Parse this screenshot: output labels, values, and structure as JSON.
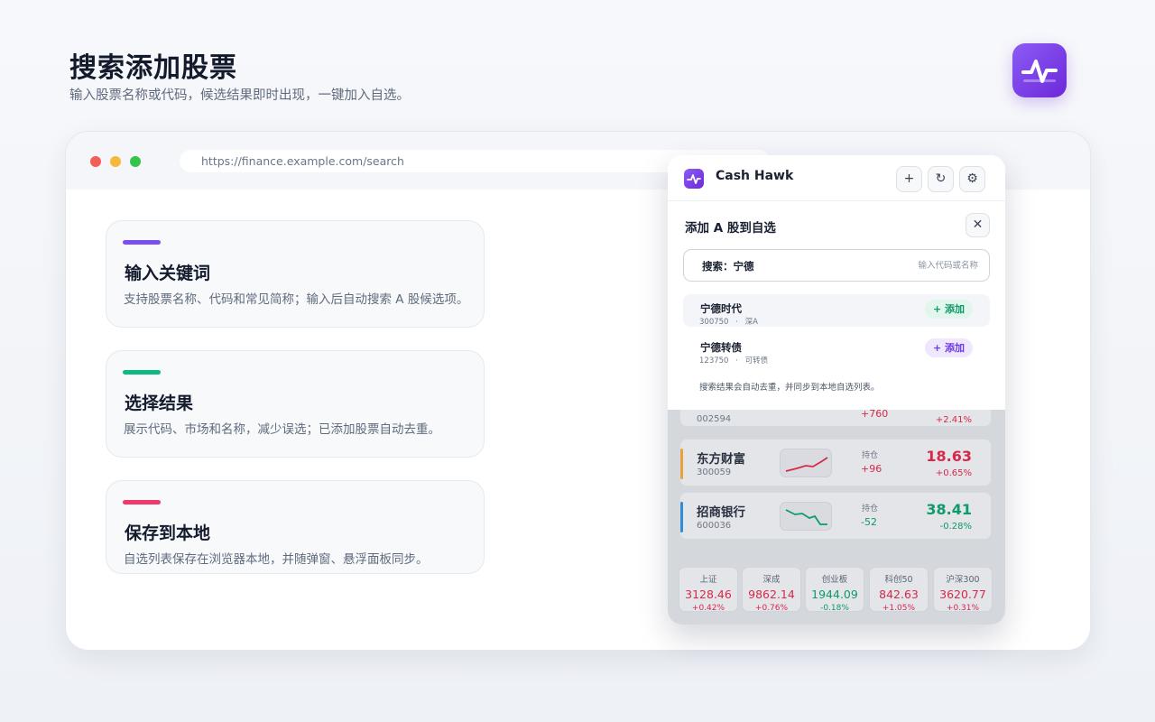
{
  "page": {
    "title": "搜索添加股票",
    "subtitle": "输入股票名称或代码，候选结果即时出现，一键加入自选。"
  },
  "browser": {
    "url": "https://finance.example.com/search"
  },
  "features": [
    {
      "title": "输入关键词",
      "desc": "支持股票名称、代码和常见简称；输入后自动搜索 A 股候选项。",
      "accent": "#7c4df0"
    },
    {
      "title": "选择结果",
      "desc": "展示代码、市场和名称，减少误选；已添加股票自动去重。",
      "accent": "#10b981"
    },
    {
      "title": "保存到本地",
      "desc": "自选列表保存在浏览器本地，并随弹窗、悬浮面板同步。",
      "accent": "#f0386b"
    }
  ],
  "panel": {
    "app_name": "Cash Hawk",
    "header_buttons": [
      {
        "name": "add-button",
        "glyph": "+"
      },
      {
        "name": "refresh-button",
        "glyph": "↻"
      },
      {
        "name": "settings-button",
        "glyph": "⚙"
      }
    ],
    "stocks": [
      {
        "name": "",
        "code": "002594",
        "hold_label": "",
        "hold_value": "+760",
        "price": "",
        "pct": "+2.41%",
        "trend": "up",
        "accent": "#7c4df0"
      },
      {
        "name": "东方财富",
        "code": "300059",
        "hold_label": "持仓",
        "hold_value": "+96",
        "price": "18.63",
        "pct": "+0.65%",
        "trend": "up",
        "accent": "#e8a23a"
      },
      {
        "name": "招商银行",
        "code": "600036",
        "hold_label": "持仓",
        "hold_value": "-52",
        "price": "38.41",
        "pct": "-0.28%",
        "trend": "down",
        "accent": "#2e8fd8"
      }
    ],
    "indices": [
      {
        "name": "上证",
        "value": "3128.46",
        "pct": "+0.42%",
        "trend": "up"
      },
      {
        "name": "深成",
        "value": "9862.14",
        "pct": "+0.76%",
        "trend": "up"
      },
      {
        "name": "创业板",
        "value": "1944.09",
        "pct": "-0.18%",
        "trend": "down"
      },
      {
        "name": "科创50",
        "value": "842.63",
        "pct": "+1.05%",
        "trend": "up"
      },
      {
        "name": "沪深300",
        "value": "3620.77",
        "pct": "+0.31%",
        "trend": "up"
      }
    ]
  },
  "popup": {
    "title": "添加 A 股到自选",
    "close_glyph": "✕",
    "search_label": "搜索：宁德",
    "search_placeholder": "输入代码或名称",
    "results": [
      {
        "name": "宁德时代",
        "code": "300750",
        "sep": "·",
        "market": "深A",
        "add_label": "+ 添加"
      },
      {
        "name": "宁德转债",
        "code": "123750",
        "sep": "·",
        "market": "可转债",
        "add_label": "+ 添加"
      }
    ],
    "note": "搜索结果会自动去重，并同步到本地自选列表。"
  }
}
